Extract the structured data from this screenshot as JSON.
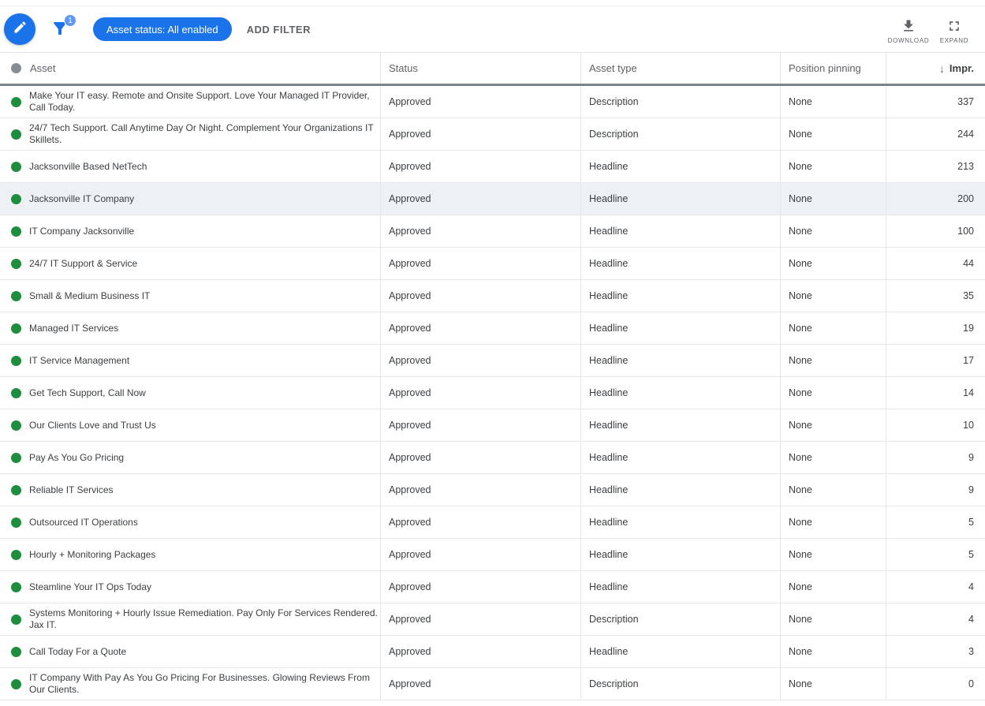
{
  "toolbar": {
    "edit_icon": "pencil-icon",
    "filter_icon": "funnel-icon",
    "filter_count_badge": "1",
    "filter_chip_label": "Asset status: All enabled",
    "add_filter_label": "ADD FILTER",
    "download_label": "DOWNLOAD",
    "expand_label": "EXPAND"
  },
  "table": {
    "header": {
      "asset": "Asset",
      "status": "Status",
      "asset_type": "Asset type",
      "position_pinning": "Position pinning",
      "impressions": "Impr.",
      "sort_icon": "↓",
      "sort_column": "Impr.",
      "sort_direction": "descending"
    },
    "rows": [
      {
        "asset": "Make Your IT easy. Remote and Onsite Support. Love Your Managed IT Provider, Call Today.",
        "status": "Approved",
        "asset_type": "Description",
        "position_pinning": "None",
        "impressions": "337",
        "highlighted": false
      },
      {
        "asset": "24/7 Tech Support. Call Anytime Day Or Night. Complement Your Organizations IT Skillets.",
        "status": "Approved",
        "asset_type": "Description",
        "position_pinning": "None",
        "impressions": "244",
        "highlighted": false
      },
      {
        "asset": "Jacksonville Based NetTech",
        "status": "Approved",
        "asset_type": "Headline",
        "position_pinning": "None",
        "impressions": "213",
        "highlighted": false
      },
      {
        "asset": "Jacksonville IT Company",
        "status": "Approved",
        "asset_type": "Headline",
        "position_pinning": "None",
        "impressions": "200",
        "highlighted": true
      },
      {
        "asset": "IT Company Jacksonville",
        "status": "Approved",
        "asset_type": "Headline",
        "position_pinning": "None",
        "impressions": "100",
        "highlighted": false
      },
      {
        "asset": "24/7 IT Support & Service",
        "status": "Approved",
        "asset_type": "Headline",
        "position_pinning": "None",
        "impressions": "44",
        "highlighted": false
      },
      {
        "asset": "Small & Medium Business IT",
        "status": "Approved",
        "asset_type": "Headline",
        "position_pinning": "None",
        "impressions": "35",
        "highlighted": false
      },
      {
        "asset": "Managed IT Services",
        "status": "Approved",
        "asset_type": "Headline",
        "position_pinning": "None",
        "impressions": "19",
        "highlighted": false
      },
      {
        "asset": "IT Service Management",
        "status": "Approved",
        "asset_type": "Headline",
        "position_pinning": "None",
        "impressions": "17",
        "highlighted": false
      },
      {
        "asset": "Get Tech Support, Call Now",
        "status": "Approved",
        "asset_type": "Headline",
        "position_pinning": "None",
        "impressions": "14",
        "highlighted": false
      },
      {
        "asset": "Our Clients Love and Trust Us",
        "status": "Approved",
        "asset_type": "Headline",
        "position_pinning": "None",
        "impressions": "10",
        "highlighted": false
      },
      {
        "asset": "Pay As You Go Pricing",
        "status": "Approved",
        "asset_type": "Headline",
        "position_pinning": "None",
        "impressions": "9",
        "highlighted": false
      },
      {
        "asset": "Reliable IT Services",
        "status": "Approved",
        "asset_type": "Headline",
        "position_pinning": "None",
        "impressions": "9",
        "highlighted": false
      },
      {
        "asset": "Outsourced IT Operations",
        "status": "Approved",
        "asset_type": "Headline",
        "position_pinning": "None",
        "impressions": "5",
        "highlighted": false
      },
      {
        "asset": "Hourly + Monitoring Packages",
        "status": "Approved",
        "asset_type": "Headline",
        "position_pinning": "None",
        "impressions": "5",
        "highlighted": false
      },
      {
        "asset": "Steamline Your IT Ops Today",
        "status": "Approved",
        "asset_type": "Headline",
        "position_pinning": "None",
        "impressions": "4",
        "highlighted": false
      },
      {
        "asset": "Systems Monitoring + Hourly Issue Remediation. Pay Only For Services Rendered. Jax IT.",
        "status": "Approved",
        "asset_type": "Description",
        "position_pinning": "None",
        "impressions": "4",
        "highlighted": false
      },
      {
        "asset": "Call Today For a Quote",
        "status": "Approved",
        "asset_type": "Headline",
        "position_pinning": "None",
        "impressions": "3",
        "highlighted": false
      },
      {
        "asset": "IT Company With Pay As You Go Pricing For Businesses. Glowing Reviews From Our Clients.",
        "status": "Approved",
        "asset_type": "Description",
        "position_pinning": "None",
        "impressions": "0",
        "highlighted": false
      }
    ]
  },
  "colors": {
    "accent_blue": "#1a73e8",
    "badge_blue": "#5e97f6",
    "enabled_green": "#1e8e3e",
    "row_highlight": "#edf1f3",
    "text_primary": "#3c4043",
    "text_secondary": "#5f6368",
    "row_border": "#e6e7e9",
    "header_bottom_border": "#7d8388"
  }
}
